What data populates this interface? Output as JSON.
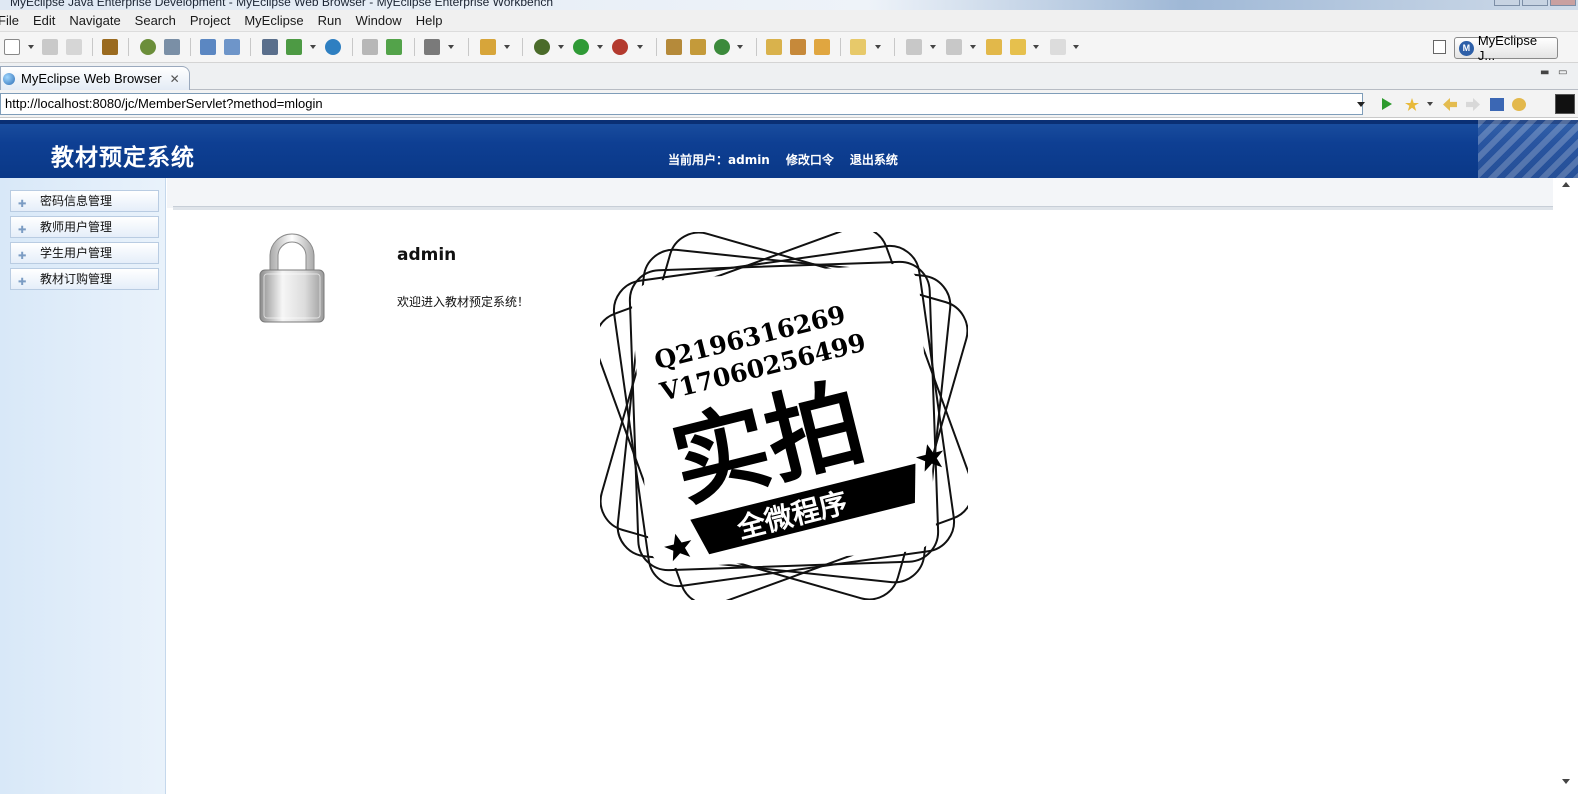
{
  "window": {
    "title": "MyEclipse Java Enterprise Development - MyEclipse Web Browser - MyEclipse Enterprise Workbench"
  },
  "menu": [
    "File",
    "Edit",
    "Navigate",
    "Search",
    "Project",
    "MyEclipse",
    "Run",
    "Window",
    "Help"
  ],
  "toolbar": {
    "perspective_label": "MyEclipse J..."
  },
  "tab": {
    "label": "MyEclipse Web Browser",
    "close": "✕"
  },
  "browser": {
    "url": "http://localhost:8080/jc/MemberServlet?method=mlogin"
  },
  "app": {
    "system_name": "教材预定系统",
    "current_user": "当前用户：admin",
    "change_password": "修改口令",
    "logout": "退出系统"
  },
  "sidebar": {
    "items": [
      {
        "label": "密码信息管理"
      },
      {
        "label": "教师用户管理"
      },
      {
        "label": "学生用户管理"
      },
      {
        "label": "教材订购管理"
      }
    ]
  },
  "main": {
    "username": "admin",
    "welcome": "欢迎进入教材预定系统！"
  },
  "watermark": {
    "line1": "Q2196316269",
    "line2": "V17060256499",
    "big": "实拍",
    "banner": "全微程序"
  }
}
